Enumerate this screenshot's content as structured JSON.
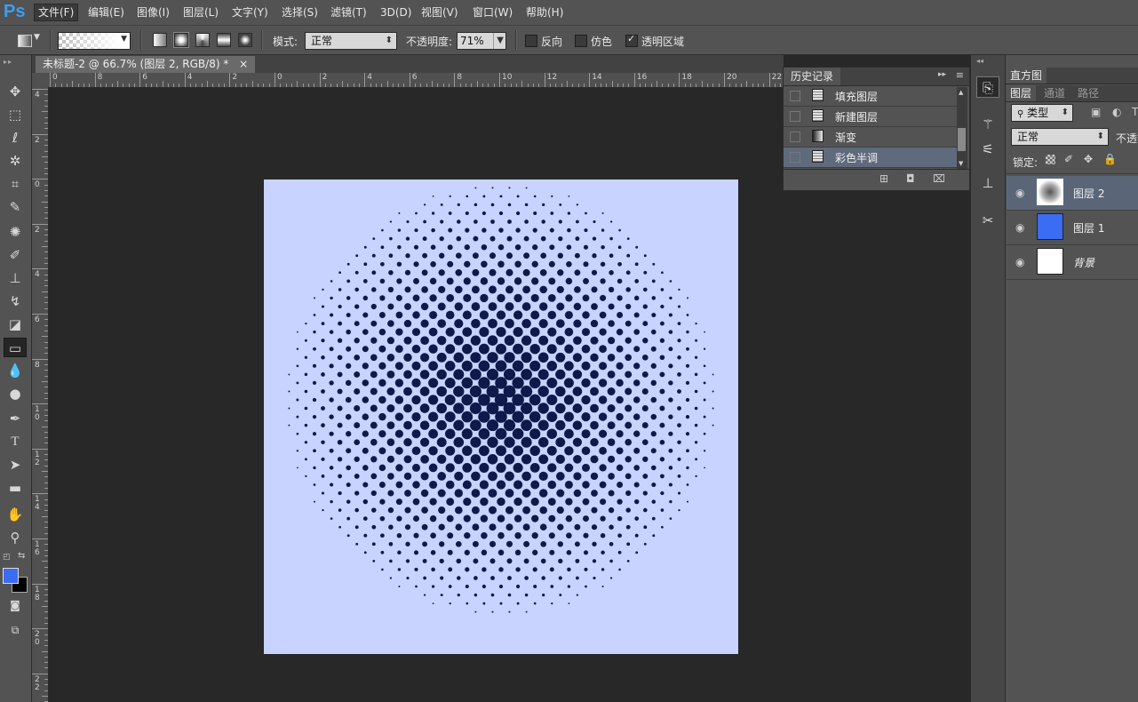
{
  "app": {
    "logo": "Ps"
  },
  "menu": [
    {
      "label": "文件(F)",
      "active": true
    },
    {
      "label": "编辑(E)"
    },
    {
      "label": "图像(I)"
    },
    {
      "label": "图层(L)"
    },
    {
      "label": "文字(Y)"
    },
    {
      "label": "选择(S)"
    },
    {
      "label": "滤镜(T)"
    },
    {
      "label": "3D(D)"
    },
    {
      "label": "视图(V)"
    },
    {
      "label": "窗口(W)"
    },
    {
      "label": "帮助(H)"
    }
  ],
  "options": {
    "mode_label": "模式:",
    "mode_value": "正常",
    "opacity_label": "不透明度:",
    "opacity_value": "71%",
    "reverse_label": "反向",
    "reverse_checked": false,
    "dither_label": "仿色",
    "dither_checked": false,
    "transparency_label": "透明区域",
    "transparency_checked": true
  },
  "document": {
    "tab_title": "未标题-2 @ 66.7% (图层 2, RGB/8) *",
    "close": "×",
    "canvas_bg": "#c8d3ff",
    "dot_color": "#0f1a4a"
  },
  "rulers": {
    "h_labels": [
      "0",
      "8",
      "6",
      "4",
      "2",
      "0",
      "2",
      "4",
      "6",
      "8",
      "10",
      "12",
      "14",
      "16",
      "18",
      "20",
      "22"
    ],
    "v_labels": [
      "4",
      "2",
      "0",
      "2",
      "4",
      "6",
      "8",
      "10",
      "12",
      "14",
      "16",
      "18",
      "20",
      "22"
    ]
  },
  "history": {
    "title": "历史记录",
    "items": [
      {
        "label": "填充图层",
        "selected": false,
        "icon": "document-icon"
      },
      {
        "label": "新建图层",
        "selected": false,
        "icon": "document-icon"
      },
      {
        "label": "渐变",
        "selected": false,
        "icon": "gradient-icon"
      },
      {
        "label": "彩色半调",
        "selected": true,
        "icon": "document-icon"
      }
    ]
  },
  "panels": {
    "histogram_tab": "直方图",
    "layers_tab": "图层",
    "channels_tab": "通道",
    "paths_tab": "路径",
    "filter_kind": "类型",
    "blend_mode": "正常",
    "opacity_label": "不透明",
    "lock_label": "锁定:"
  },
  "layers": [
    {
      "name": "图层 2",
      "selected": true,
      "thumb": "halftone",
      "italic": false
    },
    {
      "name": "图层 1",
      "selected": false,
      "thumb": "#3a6cf4",
      "italic": false
    },
    {
      "name": "背景",
      "selected": false,
      "thumb": "#ffffff",
      "italic": true
    }
  ],
  "colors": {
    "foreground": "#3a6cf4",
    "background": "#000000"
  }
}
